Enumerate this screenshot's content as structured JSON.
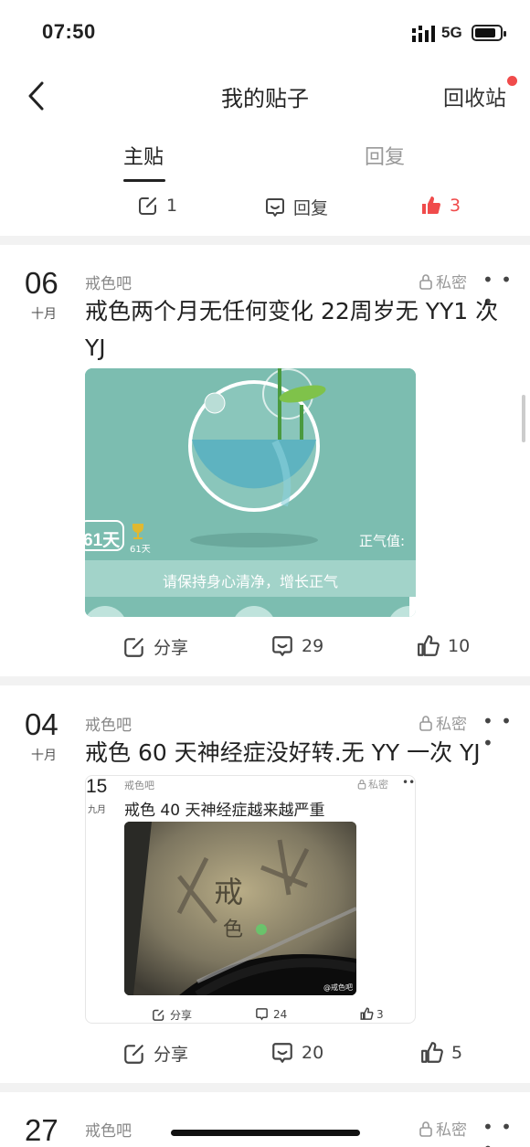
{
  "status": {
    "time": "07:50",
    "network": "5G"
  },
  "nav": {
    "title": "我的贴子",
    "recycle": "回收站"
  },
  "tabs": {
    "main": "主贴",
    "reply": "回复"
  },
  "stats": {
    "posts": "1",
    "replies_label": "回复",
    "likes": "3"
  },
  "colors": {
    "accent_red": "#f04b4b",
    "card_teal": "#7cbdb0"
  },
  "posts": [
    {
      "day": "06",
      "month": "十月",
      "forum": "戒色吧",
      "private": "私密",
      "title": "戒色两个月无任何变化 22周岁无 YY1 次 YJ",
      "image": {
        "days_badge": "61天",
        "trophy_days": "61天",
        "zhengqi_label": "正气值:",
        "banner": "请保持身心清净，增长正气"
      },
      "share": "分享",
      "comments": "29",
      "likes": "10"
    },
    {
      "day": "04",
      "month": "十月",
      "forum": "戒色吧",
      "private": "私密",
      "title": "戒色 60 天神经症没好转.无 YY 一次 YJ",
      "quoted": {
        "day": "15",
        "month": "九月",
        "forum": "戒色吧",
        "private": "私密",
        "title": "戒色 40 天神经症越来越严重",
        "image_text1": "戒",
        "image_text2": "色",
        "watermark": "@戒色吧",
        "share": "分享",
        "comments": "24",
        "likes": "3"
      },
      "share": "分享",
      "comments": "20",
      "likes": "5"
    },
    {
      "day": "27",
      "forum": "戒色吧",
      "private": "私密"
    }
  ]
}
